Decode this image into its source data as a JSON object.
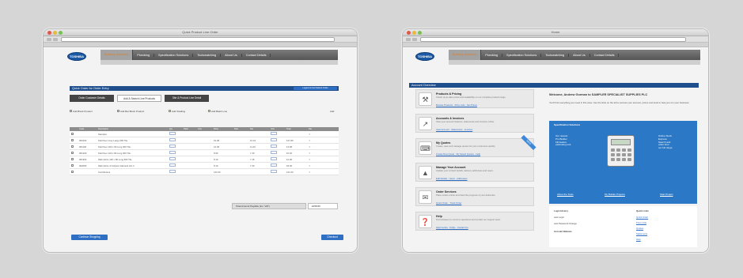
{
  "left_window": {
    "title": "Quick Product Line Order",
    "logo": "TOSHIBA",
    "menu": [
      "Building Solutions",
      "Plumbing",
      "Specification Solutions",
      "Toolswatching",
      "About Us",
      "Contact Details"
    ],
    "page_heading": "Quick Order for Order Entry",
    "header_link": "Logout & Cart Submit Order",
    "tabs": [
      "Order Customer Details",
      "Add & Search Line Products",
      "Site & Product Line Detail"
    ],
    "options": [
      "Add Block Product",
      "Add Bar Block Product",
      "Add Totalling",
      "Add Blank Line"
    ],
    "add_label": "Add",
    "table_headers": [
      "",
      "Code",
      "Description",
      "Qty",
      "Pack",
      "Unit",
      "Price",
      "Disc",
      "Net",
      "Unit",
      "Total",
      "Del"
    ],
    "rows": [
      {
        "code": "",
        "desc": "Samples"
      },
      {
        "code": "000100",
        "desc": "Flat Floor Grey Large 600 Tile",
        "price": "19.08",
        "net": "12.44",
        "total": "147.80"
      },
      {
        "code": "001100",
        "desc": "Flat Floor 100 x 60 Long 300 Tile",
        "price": "12.48",
        "net": "11.40",
        "total": "13.68"
      },
      {
        "code": "001200",
        "desc": "Flat Floor 120 x 80 Long 300 Tile",
        "price": "8.09",
        "net": "7.40",
        "total": "16.40"
      },
      {
        "code": "001300",
        "desc": "Wall Joints 120 x 80 Long 600 Tile",
        "price": "8.10",
        "net": "7.15",
        "total": "12.96"
      },
      {
        "code": "002000",
        "desc": "Wall Joints 4 Outputs Cabinets Oct 4",
        "price": "8.10",
        "net": "7.30",
        "total": "18.00"
      },
      {
        "code": "",
        "desc": "Contributors",
        "price": "142.00",
        "total": "121.00"
      }
    ],
    "total_label": "Total Amount Payable (inc. VAT)",
    "total_value": "£298.80",
    "left_button": "Continue Shopping",
    "right_button": "Checkout"
  },
  "right_window": {
    "title": "Home",
    "logo": "TOSHIBA",
    "menu": [
      "Building Solutions",
      "Plumbing",
      "Specification Solutions",
      "Toolswatching",
      "About Us",
      "Contact Details"
    ],
    "section_heading": "Account Overview",
    "cards": [
      {
        "title": "Products & Pricing",
        "desc": "Check up-to-date prices and availability on our complete product range.",
        "links": "Browse Products  ·  Price Lists  ·  Net Prices"
      },
      {
        "title": "Accounts & Invoices",
        "desc": "View your account balance, statements and invoices online.",
        "links": "View Account  ·  Statements  ·  Invoices"
      },
      {
        "title": "My Quotes",
        "desc": "Create, save and manage quotes for your customers quickly.",
        "links": "Create New Quote  ·  My Saved Quotes  ·  Help",
        "ribbon": "NEW"
      },
      {
        "title": "Manage Your Account",
        "desc": "Update your contact details, delivery addresses and users.",
        "links": "Edit Details  ·  Users  ·  Addresses"
      },
      {
        "title": "Order Services",
        "desc": "Place orders online and track the progress of your deliveries.",
        "links": "Quick Order  ·  Track Order"
      },
      {
        "title": "Help",
        "desc": "Find answers to common questions and contact our support team.",
        "links": "Help Centre  ·  FAQs  ·  Contact Us"
      }
    ],
    "welcome_title": "Welcome, Andrew Gorman to SAMPLER SPECIALIST SUPPLIES PLC",
    "welcome_text": "You'll find everything you need in this area. Use the links on the left to access your account, prices and tools to help you run your business.",
    "panel_heading": "Specification Solutions",
    "panel_left": "Our newest\nPro Builder\nfull feature\nestimating tool",
    "panel_right": "Online Stock\nExpress\nSearch and\norder from\nour full range",
    "panel_links": [
      "About the Tools",
      "My Builder Projects",
      "Start Project"
    ],
    "info_left": [
      "Login History",
      "Last Login",
      "Last Password Change",
      "Account Balance"
    ],
    "info_right": [
      "Quick Links",
      "Quick Order",
      "Price Lists",
      "Quotes",
      "Statements",
      "Help"
    ]
  }
}
